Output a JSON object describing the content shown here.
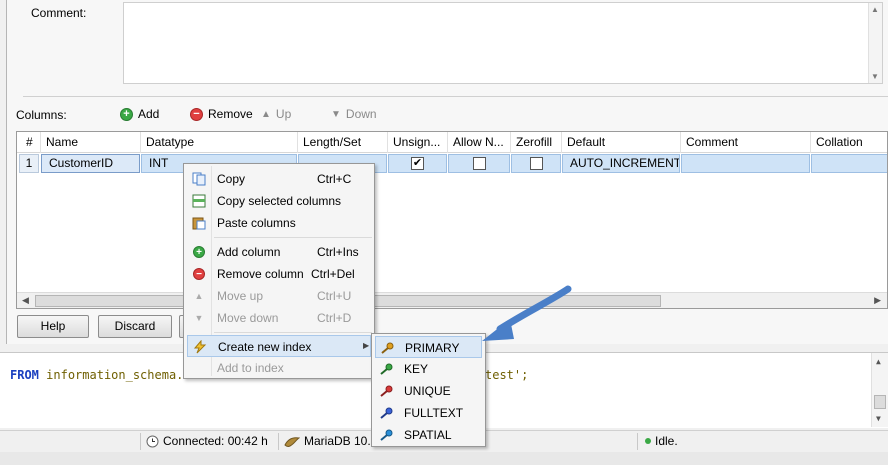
{
  "comment": {
    "label": "Comment:",
    "value": ""
  },
  "columns_toolbar": {
    "label": "Columns:",
    "add": "Add",
    "remove": "Remove",
    "up": "Up",
    "down": "Down"
  },
  "grid": {
    "headers": [
      "#",
      "Name",
      "Datatype",
      "Length/Set",
      "Unsign...",
      "Allow N...",
      "Zerofill",
      "Default",
      "Comment",
      "Collation"
    ],
    "rows": [
      {
        "num": "1",
        "name": "CustomerID",
        "datatype": "INT",
        "length": "",
        "unsigned": true,
        "allow_null": false,
        "zerofill": false,
        "default": "AUTO_INCREMENT",
        "comment": "",
        "collation": ""
      }
    ]
  },
  "buttons": {
    "help": "Help",
    "discard": "Discard"
  },
  "context_menu": {
    "items": [
      {
        "label": "Copy",
        "shortcut": "Ctrl+C",
        "icon": "copy-icon",
        "enabled": true
      },
      {
        "label": "Copy selected columns",
        "shortcut": "",
        "icon": "copy-columns-icon",
        "enabled": true
      },
      {
        "label": "Paste columns",
        "shortcut": "",
        "icon": "paste-icon",
        "enabled": true
      },
      {
        "label": "Add column",
        "shortcut": "Ctrl+Ins",
        "icon": "add-icon",
        "enabled": true
      },
      {
        "label": "Remove column",
        "shortcut": "Ctrl+Del",
        "icon": "remove-icon",
        "enabled": true
      },
      {
        "label": "Move up",
        "shortcut": "Ctrl+U",
        "icon": "up-arrow-icon",
        "enabled": false
      },
      {
        "label": "Move down",
        "shortcut": "Ctrl+D",
        "icon": "down-arrow-icon",
        "enabled": false
      },
      {
        "label": "Create new index",
        "shortcut": "",
        "icon": "lightning-icon",
        "enabled": true,
        "highlighted": true
      },
      {
        "label": "Add to index",
        "shortcut": "",
        "icon": "",
        "enabled": false
      }
    ]
  },
  "index_submenu": {
    "items": [
      {
        "label": "PRIMARY",
        "icon": "key-gold-icon",
        "color": "#e0a020",
        "highlighted": true
      },
      {
        "label": "KEY",
        "icon": "key-green-icon",
        "color": "#3aa845"
      },
      {
        "label": "UNIQUE",
        "icon": "key-red-icon",
        "color": "#d83a3a"
      },
      {
        "label": "FULLTEXT",
        "icon": "key-blue-icon",
        "color": "#3a62d8"
      },
      {
        "label": "SPATIAL",
        "icon": "key-lightblue-icon",
        "color": "#2a8fd8"
      }
    ]
  },
  "query": {
    "keyword": "FROM",
    "ident": "information_schema.`",
    "tail": "test';"
  },
  "statusbar": {
    "connected": "Connected: 00:42 h",
    "server": "MariaDB 10.1",
    "idle": "Idle."
  },
  "colors": {
    "selection": "#cfe3f7",
    "accent_arrow": "#4a7fc8"
  }
}
